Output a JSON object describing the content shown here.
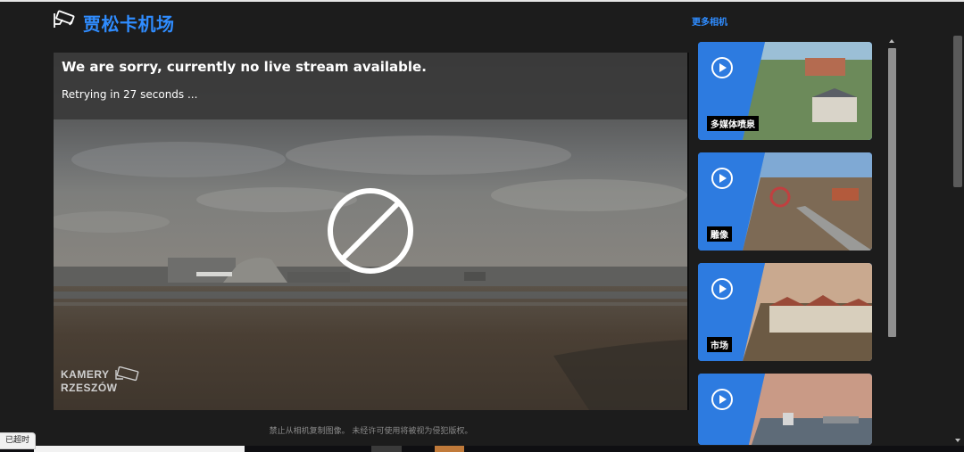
{
  "header": {
    "title": "贾松卡机场",
    "logo_icon": "camera-icon",
    "more_link": "更多相机"
  },
  "player": {
    "error_title": "We are sorry, currently no live stream available.",
    "retry_text": "Retrying in 27 seconds ...",
    "status_icon": "no-entry-icon",
    "watermark_line1": "KAMERY",
    "watermark_line2": "RZESZÓW"
  },
  "footer": {
    "copyright_note": "禁止从相机复制图像。 未经许可使用将被视为侵犯版权。"
  },
  "sidebar": {
    "cameras": [
      {
        "label": "多媒体喷泉",
        "icon": "play-icon"
      },
      {
        "label": "雕像",
        "icon": "play-icon"
      },
      {
        "label": "市场",
        "icon": "play-icon"
      },
      {
        "label": "",
        "icon": "play-icon"
      }
    ]
  },
  "status": {
    "tooltip": "已超时"
  },
  "colors": {
    "accent": "#2f8cff",
    "card_blue": "#2e7be0",
    "background": "#1c1c1c"
  }
}
